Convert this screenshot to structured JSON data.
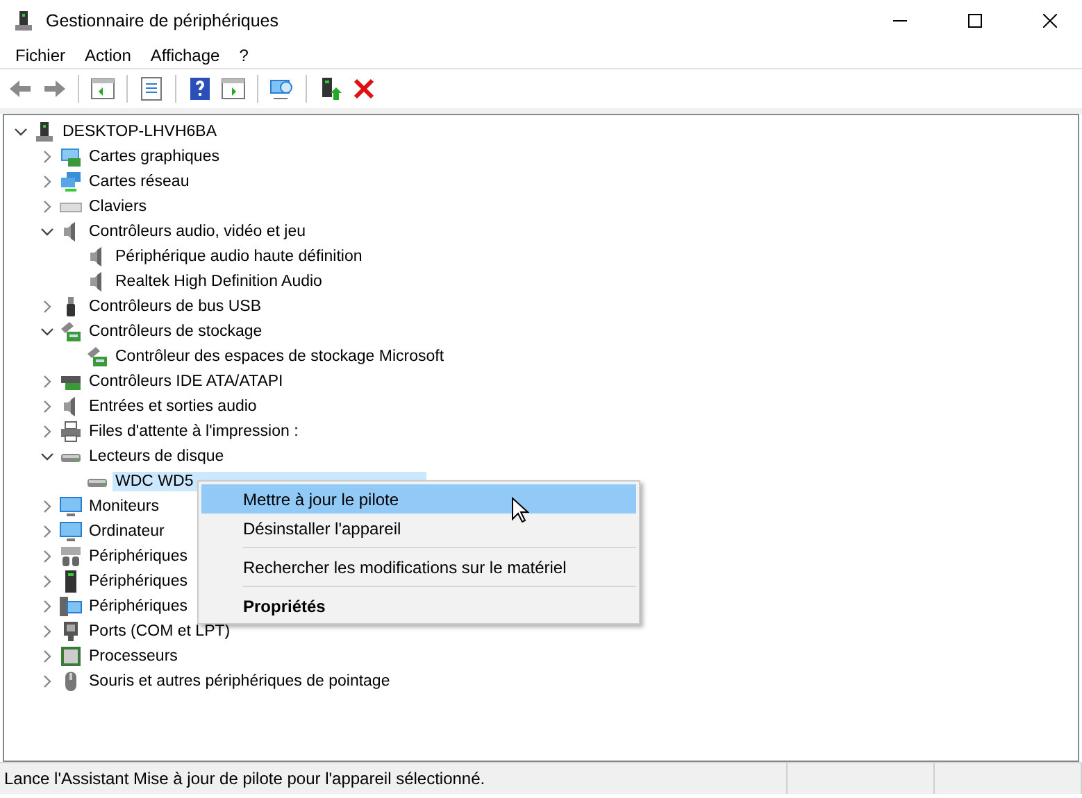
{
  "window": {
    "title": "Gestionnaire de périphériques"
  },
  "menu_bar": [
    "Fichier",
    "Action",
    "Affichage",
    "?"
  ],
  "toolbar": [
    {
      "kind": "back",
      "disabled": false
    },
    {
      "kind": "forward",
      "disabled": false
    },
    {
      "kind": "separator"
    },
    {
      "kind": "console-tree",
      "disabled": false
    },
    {
      "kind": "separator"
    },
    {
      "kind": "properties",
      "disabled": false
    },
    {
      "kind": "separator"
    },
    {
      "kind": "help",
      "disabled": false
    },
    {
      "kind": "action-pane",
      "disabled": false
    },
    {
      "kind": "separator"
    },
    {
      "kind": "scan",
      "disabled": false
    },
    {
      "kind": "separator"
    },
    {
      "kind": "update-driver",
      "disabled": false
    },
    {
      "kind": "uninstall",
      "disabled": false
    }
  ],
  "tree": {
    "label": "DESKTOP-LHVH6BA",
    "expanded": true,
    "selected": false,
    "children": [
      {
        "label": "Cartes graphiques",
        "expanded": false,
        "selected": false
      },
      {
        "label": "Cartes réseau",
        "expanded": false,
        "selected": false
      },
      {
        "label": "Claviers",
        "expanded": false,
        "selected": false
      },
      {
        "label": "Contrôleurs audio, vidéo et jeu",
        "expanded": true,
        "selected": false,
        "children": [
          {
            "label": "Périphérique audio haute définition",
            "selected": false
          },
          {
            "label": "Realtek High Definition Audio",
            "selected": false
          }
        ]
      },
      {
        "label": "Contrôleurs de bus USB",
        "expanded": false,
        "selected": false
      },
      {
        "label": "Contrôleurs de stockage",
        "expanded": true,
        "selected": false,
        "children": [
          {
            "label": "Contrôleur des espaces de stockage Microsoft",
            "selected": false
          }
        ]
      },
      {
        "label": "Contrôleurs IDE ATA/ATAPI",
        "expanded": false,
        "selected": false
      },
      {
        "label": "Entrées et sorties audio",
        "expanded": false,
        "selected": false
      },
      {
        "label": "Files d'attente à l'impression :",
        "expanded": false,
        "selected": false
      },
      {
        "label": "Lecteurs de disque",
        "expanded": true,
        "selected": false,
        "children": [
          {
            "label": "WDC WD5",
            "selected": true
          }
        ]
      },
      {
        "label": "Moniteurs",
        "expanded": false,
        "selected": false
      },
      {
        "label": "Ordinateur",
        "expanded": false,
        "selected": false
      },
      {
        "label": "Périphériques",
        "expanded": false,
        "selected": false
      },
      {
        "label": "Périphériques",
        "expanded": false,
        "selected": false
      },
      {
        "label": "Périphériques",
        "expanded": false,
        "selected": false
      },
      {
        "label": "Ports (COM et LPT)",
        "expanded": false,
        "selected": false
      },
      {
        "label": "Processeurs",
        "expanded": false,
        "selected": false
      },
      {
        "label": "Souris et autres périphériques de pointage",
        "expanded": false,
        "selected": false
      }
    ]
  },
  "context_menu": [
    {
      "kind": "item",
      "label": "Mettre à jour le pilote",
      "selected": true,
      "default": false
    },
    {
      "kind": "item",
      "label": "Désinstaller l'appareil",
      "selected": false,
      "default": false
    },
    {
      "kind": "separator"
    },
    {
      "kind": "item",
      "label": "Rechercher les modifications sur le matériel",
      "selected": false,
      "default": false
    },
    {
      "kind": "separator"
    },
    {
      "kind": "item",
      "label": "Propriétés",
      "selected": false,
      "default": true
    }
  ],
  "status_bar": "Lance l'Assistant Mise à jour de pilote pour l'appareil sélectionné."
}
